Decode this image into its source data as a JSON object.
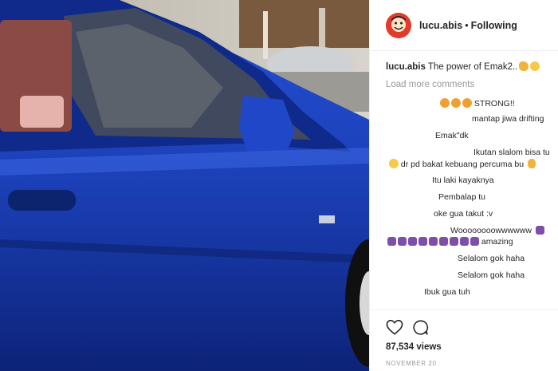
{
  "header": {
    "username": "lucu.abis",
    "separator": "•",
    "follow_status": "Following"
  },
  "caption": {
    "username": "lucu.abis",
    "text": "The power of Emak2.."
  },
  "load_more": "Load more comments",
  "comments": [
    "STRONG!!",
    "mantap jiwa drifting",
    "Emak\"dk",
    "Ikutan slalom bisa tu",
    "dr pd bakat kebuang percuma bu",
    "Itu laki kayaknya",
    "Pembalap tu",
    "oke gua takut :v",
    "Woooooooowwwwww",
    "amazing",
    "Selalom gok haha",
    "Selalom gok haha",
    "Ibuk gua tuh"
  ],
  "views": "87,534 views",
  "date": "NOVEMBER 20",
  "icons": {
    "heart": "heart-icon",
    "comment": "comment-icon",
    "avatar": "avatar"
  },
  "colors": {
    "car_blue": "#1a3fb8",
    "text": "#262626",
    "muted": "#999999",
    "avatar_red": "#e23b2c"
  }
}
